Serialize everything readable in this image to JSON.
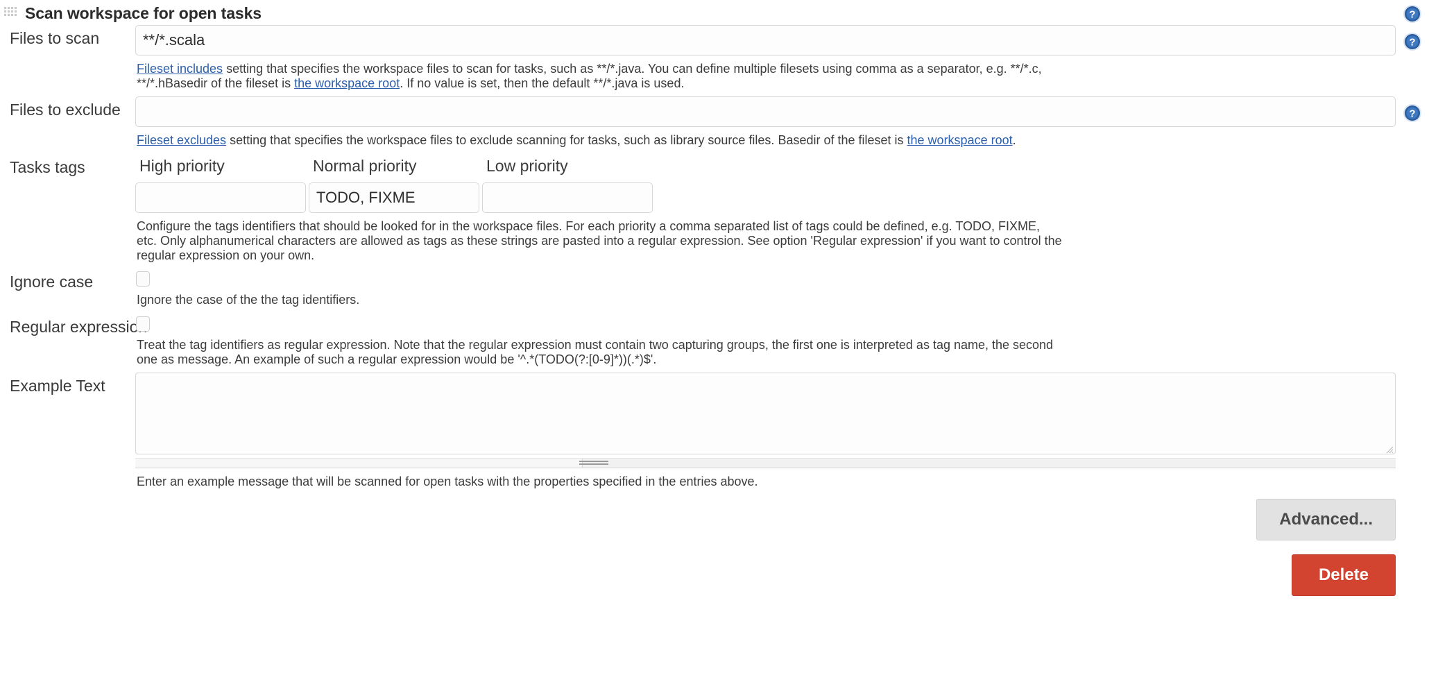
{
  "panel": {
    "title": "Scan workspace for open tasks",
    "drag_handle_icon": "drag-grip-icon",
    "help_icon": "help-circle-icon"
  },
  "fields": {
    "files_to_scan": {
      "label": "Files to scan",
      "value": "**/*.scala",
      "placeholder": "",
      "description_link_1": "Fileset includes",
      "description_part_1": " setting that specifies the workspace files to scan for tasks, such as **/*.java. You can define multiple filesets using comma as a separator, e.g. **/*.c, **/*.hBasedir of the fileset is ",
      "description_link_2": "the workspace root",
      "description_part_2": ". If no value is set, then the default **/*.java is used."
    },
    "files_to_exclude": {
      "label": "Files to exclude",
      "value": "",
      "placeholder": "",
      "description_link_1": "Fileset excludes",
      "description_part_1": " setting that specifies the workspace files to exclude scanning for tasks, such as library source files. Basedir of the fileset is ",
      "description_link_2": "the workspace root",
      "description_part_2": "."
    },
    "tasks_tags": {
      "label": "Tasks tags",
      "columns": [
        {
          "header": "High priority",
          "value": "",
          "placeholder": ""
        },
        {
          "header": "Normal priority",
          "value": "TODO, FIXME",
          "placeholder": ""
        },
        {
          "header": "Low priority",
          "value": "",
          "placeholder": ""
        }
      ],
      "description": "Configure the tags identifiers that should be looked for in the workspace files. For each priority a comma separated list of tags could be defined, e.g. TODO, FIXME, etc. Only alphanumerical characters are allowed as tags as these strings are pasted into a regular expression. See option 'Regular expression' if you want to control the regular expression on your own."
    },
    "ignore_case": {
      "label": "Ignore case",
      "checked": false,
      "description": "Ignore the case of the the tag identifiers."
    },
    "regular_expression": {
      "label": "Regular expression",
      "checked": false,
      "description": "Treat the tag identifiers as regular expression. Note that the regular expression must contain two capturing groups, the first one is interpreted as tag name, the second one as message. An example of such a regular expression would be '^.*(TODO(?:[0-9]*))(.*)$'."
    },
    "example_text": {
      "label": "Example Text",
      "value": "",
      "placeholder": "",
      "description": "Enter an example message that will be scanned for open tasks with the properties specified in the entries above."
    }
  },
  "buttons": {
    "advanced": "Advanced...",
    "delete": "Delete"
  },
  "colors": {
    "link": "#2b5eab",
    "delete_bg": "#d2442f",
    "advanced_bg": "#e2e2e2",
    "help_icon": "#2b5c9e"
  }
}
